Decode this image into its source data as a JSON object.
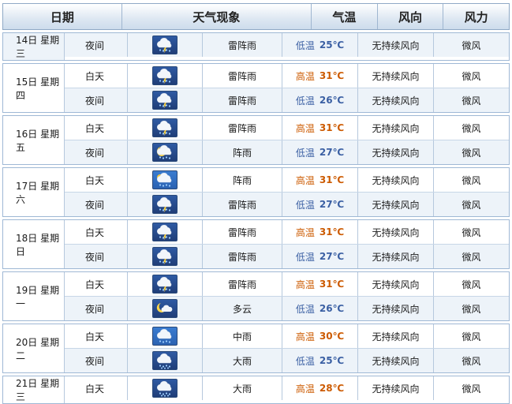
{
  "headers": [
    "日期",
    "天气现象",
    "气温",
    "风向",
    "风力"
  ],
  "high_label": "高温",
  "low_label": "低温",
  "days": [
    {
      "date": "14日  星期三",
      "rows": [
        {
          "period": "夜间",
          "night": true,
          "icon": "thunderstorm-icon",
          "weather": "雷阵雨",
          "temp": "25℃",
          "wind_dir": "无持续风向",
          "wind_force": "微风"
        }
      ]
    },
    {
      "date": "15日  星期四",
      "rows": [
        {
          "period": "白天",
          "night": false,
          "icon": "thunderstorm-icon",
          "weather": "雷阵雨",
          "temp": "31℃",
          "wind_dir": "无持续风向",
          "wind_force": "微风"
        },
        {
          "period": "夜间",
          "night": true,
          "icon": "thunderstorm-icon",
          "weather": "雷阵雨",
          "temp": "26℃",
          "wind_dir": "无持续风向",
          "wind_force": "微风"
        }
      ]
    },
    {
      "date": "16日  星期五",
      "rows": [
        {
          "period": "白天",
          "night": false,
          "icon": "thunderstorm-icon",
          "weather": "雷阵雨",
          "temp": "31℃",
          "wind_dir": "无持续风向",
          "wind_force": "微风"
        },
        {
          "period": "夜间",
          "night": true,
          "icon": "moon-shower-icon",
          "weather": "阵雨",
          "temp": "27℃",
          "wind_dir": "无持续风向",
          "wind_force": "微风"
        }
      ]
    },
    {
      "date": "17日  星期六",
      "rows": [
        {
          "period": "白天",
          "night": false,
          "icon": "sun-shower-icon",
          "weather": "阵雨",
          "temp": "31℃",
          "wind_dir": "无持续风向",
          "wind_force": "微风"
        },
        {
          "period": "夜间",
          "night": true,
          "icon": "thunderstorm-icon",
          "weather": "雷阵雨",
          "temp": "27℃",
          "wind_dir": "无持续风向",
          "wind_force": "微风"
        }
      ]
    },
    {
      "date": "18日  星期日",
      "rows": [
        {
          "period": "白天",
          "night": false,
          "icon": "thunderstorm-icon",
          "weather": "雷阵雨",
          "temp": "31℃",
          "wind_dir": "无持续风向",
          "wind_force": "微风"
        },
        {
          "period": "夜间",
          "night": true,
          "icon": "thunderstorm-icon",
          "weather": "雷阵雨",
          "temp": "27℃",
          "wind_dir": "无持续风向",
          "wind_force": "微风"
        }
      ]
    },
    {
      "date": "19日  星期一",
      "rows": [
        {
          "period": "白天",
          "night": false,
          "icon": "thunderstorm-icon",
          "weather": "雷阵雨",
          "temp": "31℃",
          "wind_dir": "无持续风向",
          "wind_force": "微风"
        },
        {
          "period": "夜间",
          "night": true,
          "icon": "moon-cloud-icon",
          "weather": "多云",
          "temp": "26℃",
          "wind_dir": "无持续风向",
          "wind_force": "微风"
        }
      ]
    },
    {
      "date": "20日  星期二",
      "rows": [
        {
          "period": "白天",
          "night": false,
          "icon": "rain-icon",
          "weather": "中雨",
          "temp": "30℃",
          "wind_dir": "无持续风向",
          "wind_force": "微风"
        },
        {
          "period": "夜间",
          "night": true,
          "icon": "heavy-rain-icon",
          "weather": "大雨",
          "temp": "25℃",
          "wind_dir": "无持续风向",
          "wind_force": "微风"
        }
      ]
    },
    {
      "date": "21日  星期三",
      "rows": [
        {
          "period": "白天",
          "night": false,
          "icon": "heavy-rain-icon",
          "weather": "大雨",
          "temp": "28℃",
          "wind_dir": "无持续风向",
          "wind_force": "微风"
        }
      ]
    }
  ]
}
